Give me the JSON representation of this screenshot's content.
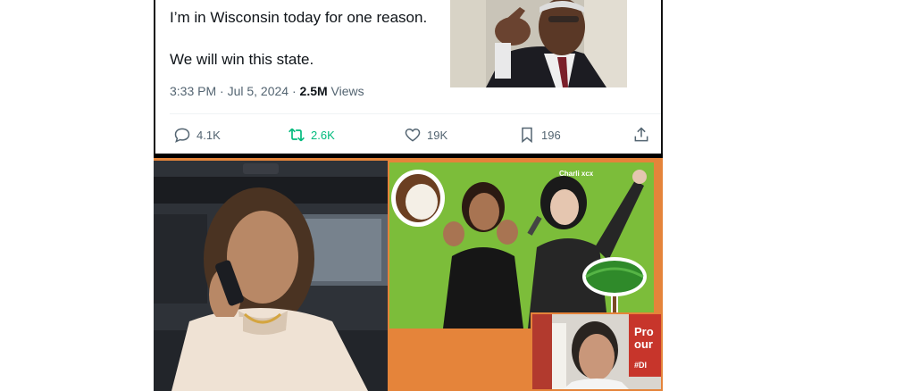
{
  "tweet": {
    "line1": "I’m in Wisconsin today for one reason.",
    "line2": "We will win this state.",
    "time": "3:33 PM · Jul 5, 2024 · ",
    "views_count": "2.5M",
    "views_label": " Views",
    "actions": {
      "replies": "4.1K",
      "reposts": "2.6K",
      "likes": "19K",
      "bookmarks": "196"
    }
  },
  "collage": {
    "charli_label": "Charli xcx",
    "sign_text_1": "Pro",
    "sign_text_2": "our",
    "sign_text_3": "#DI"
  },
  "colors": {
    "collage_border": "#e5843a",
    "green_panel": "#7cbd3a",
    "repost_active": "#00ba7c"
  }
}
